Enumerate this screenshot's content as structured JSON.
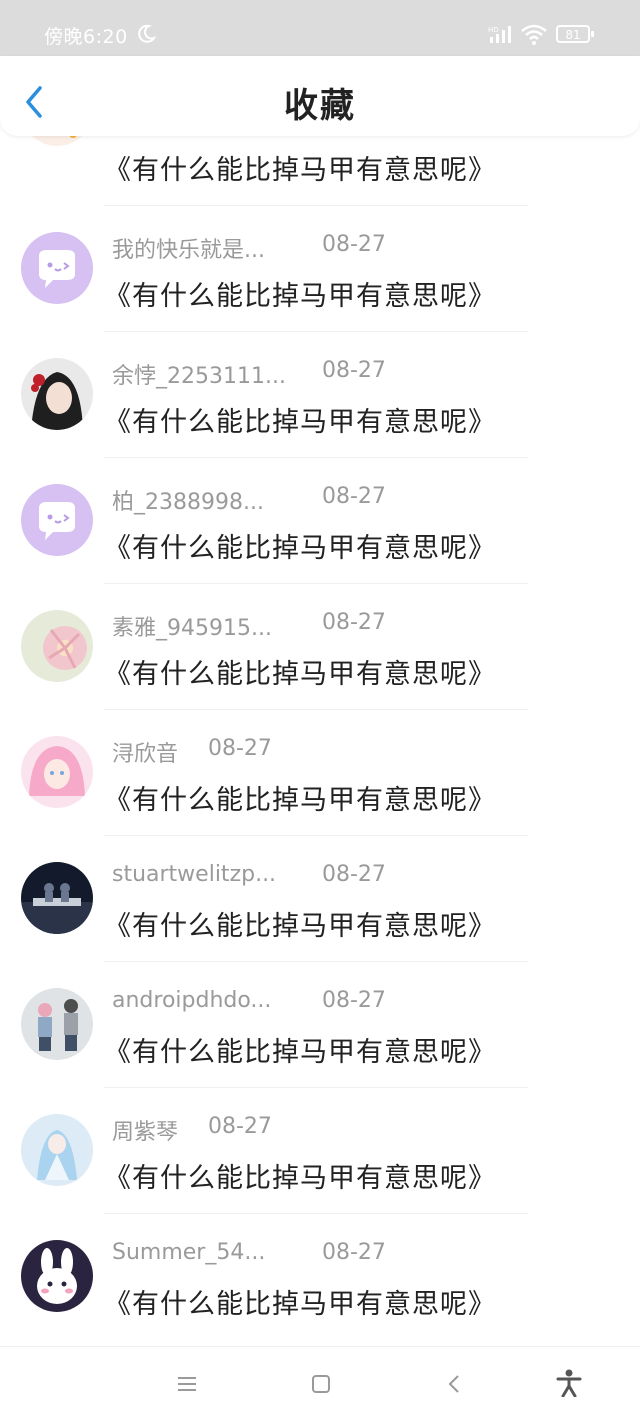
{
  "status_bar": {
    "time": "傍晚6:20",
    "battery": "81"
  },
  "header": {
    "title": "收藏"
  },
  "items": [
    {
      "user": "",
      "date": "",
      "title": "《有什么能比掉马甲有意思呢》"
    },
    {
      "user": "我的快乐就是...",
      "date": "08-27",
      "title": "《有什么能比掉马甲有意思呢》"
    },
    {
      "user": "余悖_2253111...",
      "date": "08-27",
      "title": "《有什么能比掉马甲有意思呢》"
    },
    {
      "user": "柏_2388998...",
      "date": "08-27",
      "title": "《有什么能比掉马甲有意思呢》"
    },
    {
      "user": "素雅_945915...",
      "date": "08-27",
      "title": "《有什么能比掉马甲有意思呢》"
    },
    {
      "user": "浔欣音",
      "date": "08-27",
      "title": "《有什么能比掉马甲有意思呢》"
    },
    {
      "user": "stuartwelitzp...",
      "date": "08-27",
      "title": "《有什么能比掉马甲有意思呢》"
    },
    {
      "user": "androipdhdo...",
      "date": "08-27",
      "title": "《有什么能比掉马甲有意思呢》"
    },
    {
      "user": "周紫琴",
      "date": "08-27",
      "title": "《有什么能比掉马甲有意思呢》"
    },
    {
      "user": "Summer_54...",
      "date": "08-27",
      "title": "《有什么能比掉马甲有意思呢》"
    }
  ],
  "colors": {
    "accent": "#2b8fe0",
    "meta_text": "#9a9a9a",
    "title_text": "#222222"
  }
}
